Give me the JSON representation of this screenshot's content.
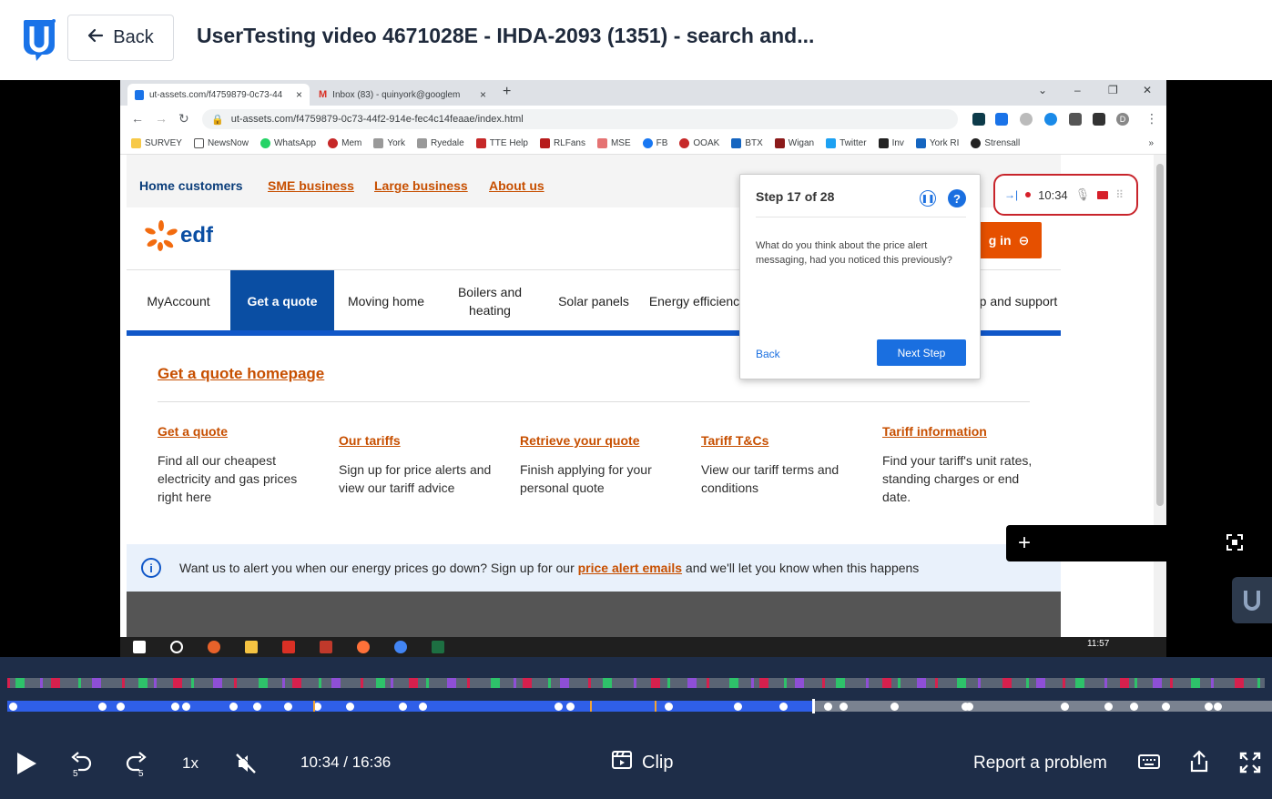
{
  "header": {
    "back_label": "Back",
    "title": "UserTesting video 4671028E - IHDA-2093 (1351) - search and..."
  },
  "browser": {
    "tabs": [
      {
        "label": "ut-assets.com/f4759879-0c73-44"
      },
      {
        "label": "Inbox (83) - quinyork@googlem"
      }
    ],
    "url": "ut-assets.com/f4759879-0c73-44f2-914e-fec4c14feaae/index.html",
    "profile_initial": "D",
    "bookmarks": [
      "SURVEY",
      "NewsNow",
      "WhatsApp",
      "Mem",
      "York",
      "Ryedale",
      "TTE Help",
      "RLFans",
      "MSE",
      "FB",
      "OOAK",
      "BTX",
      "Wigan",
      "Twitter",
      "Inv",
      "York RI",
      "Strensall"
    ]
  },
  "site": {
    "segments": [
      "Home customers",
      "SME business",
      "Large business",
      "About us"
    ],
    "logo_text": "edf",
    "login_label": "g in",
    "nav": [
      "MyAccount",
      "Get a quote",
      "Moving home",
      "Boilers and heating",
      "Solar panels",
      "Energy efficiency",
      "Help and support"
    ],
    "section_title": "Get a quote homepage",
    "columns": [
      {
        "heading": "Get a quote",
        "text": "Find all our cheapest electricity and gas prices right here"
      },
      {
        "heading": "Our tariffs",
        "text": "Sign up for price alerts and view our tariff advice"
      },
      {
        "heading": "Retrieve your quote",
        "text": "Finish applying for your personal quote"
      },
      {
        "heading": "Tariff T&Cs",
        "text": "View our tariff terms and conditions"
      },
      {
        "heading": "Tariff information",
        "text": "Find your tariff's unit rates, standing charges or end date."
      }
    ],
    "alert": {
      "pre": "Want us to alert you when our energy prices go down? Sign up for our",
      "link": "price alert emails",
      "post": "and we'll let you know when this happens"
    }
  },
  "step": {
    "title": "Step 17 of 28",
    "question": "What do you think about the price alert messaging, had you noticed this previously?",
    "back_label": "Back",
    "next_label": "Next Step"
  },
  "recorder": {
    "time": "10:34"
  },
  "taskbar": {
    "time": "11:57"
  },
  "player": {
    "speed": "1x",
    "time": "10:34 / 16:36",
    "clip_label": "Clip",
    "report_label": "Report a problem",
    "progress_fraction": 0.637
  },
  "colors": {
    "brand_blue": "#1057c8",
    "edf_orange": "#e65000",
    "player_bg": "#1e2d48",
    "progress": "#2f5fe8"
  }
}
